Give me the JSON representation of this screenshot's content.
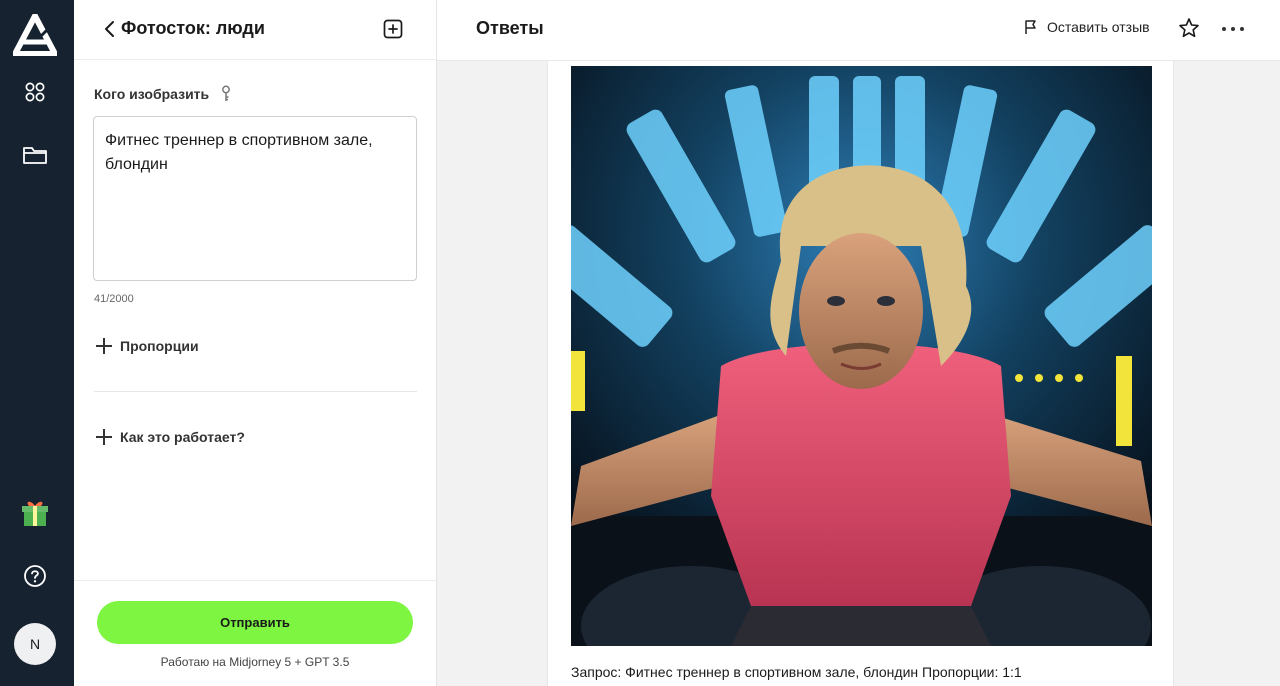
{
  "nav": {
    "logo_icon": "logo-icon",
    "items": [
      {
        "name": "apps-icon"
      },
      {
        "name": "folder-icon"
      },
      {
        "name": "gift-icon"
      },
      {
        "name": "help-icon"
      }
    ],
    "avatar_initial": "N"
  },
  "panel": {
    "title": "Фотосток: люди",
    "field_label": "Кого изобразить",
    "prompt_value": "Фитнес треннер в спортивном зале, блондин",
    "counter": "41/2000",
    "sections": [
      {
        "label": "Пропорции"
      },
      {
        "label": "Как это работает?"
      }
    ],
    "submit_label": "Отправить",
    "engine_note": "Работаю на Midjorney 5 + GPT 3.5"
  },
  "main": {
    "title": "Ответы",
    "feedback_label": "Оставить отзыв",
    "caption": "Запрос: Фитнес треннер в спортивном зале, блондин Пропорции: 1:1"
  },
  "colors": {
    "rail": "#16222f",
    "accent_button": "#7df541",
    "shirt": "#e04a6a"
  }
}
